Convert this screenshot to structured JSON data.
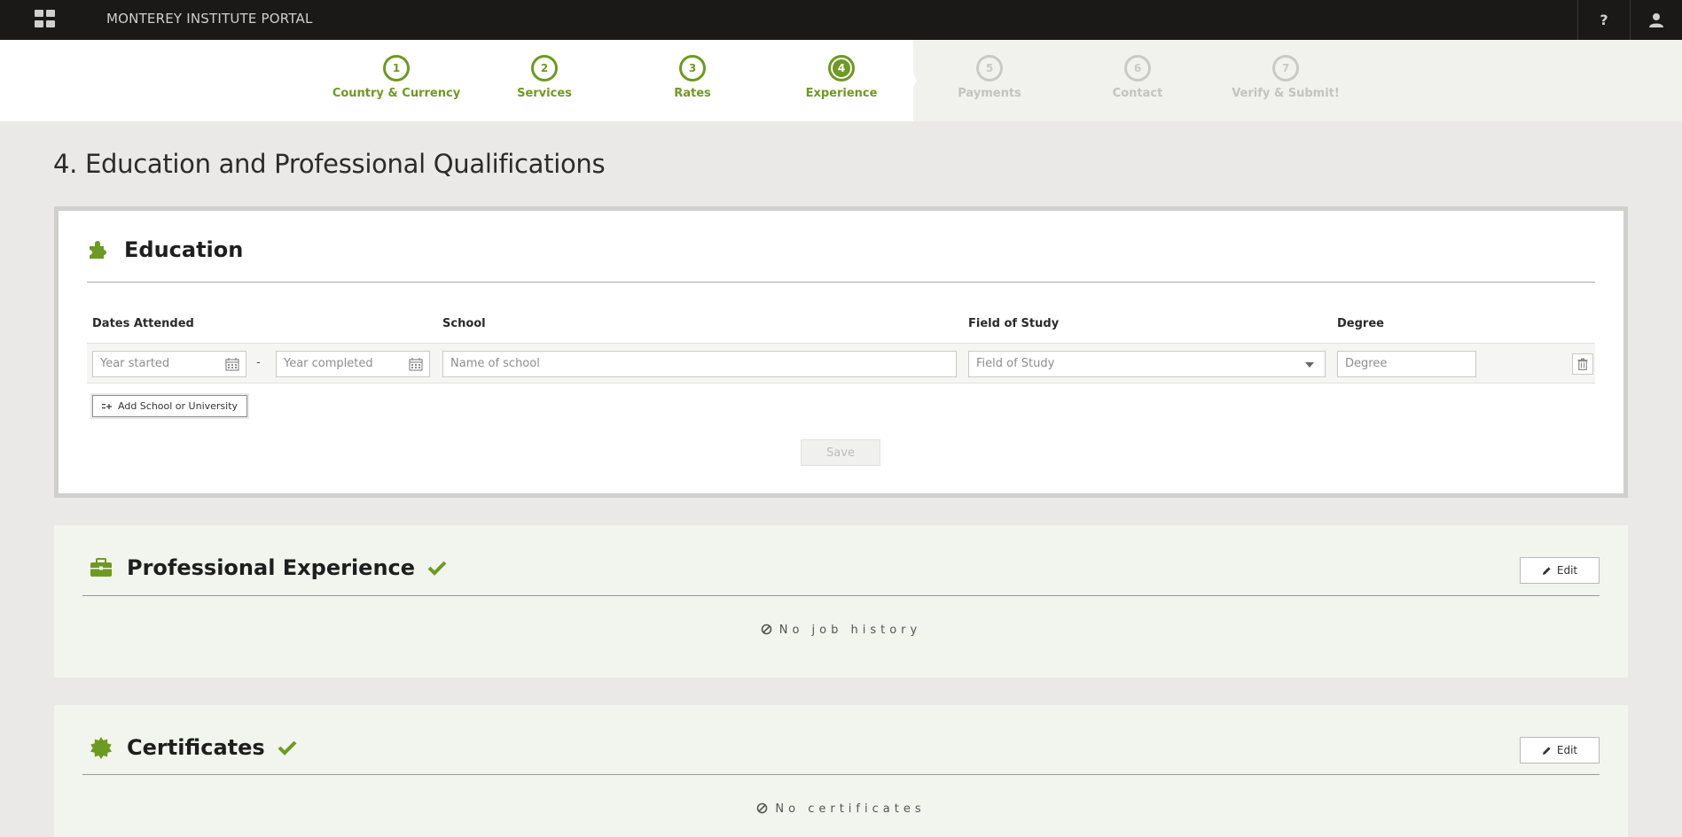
{
  "app": {
    "title": "MONTEREY INSTITUTE PORTAL",
    "help_label": "?"
  },
  "steps": [
    {
      "number": "1",
      "label": "Country & Currency",
      "state": "done"
    },
    {
      "number": "2",
      "label": "Services",
      "state": "done"
    },
    {
      "number": "3",
      "label": "Rates",
      "state": "done"
    },
    {
      "number": "4",
      "label": "Experience",
      "state": "current"
    },
    {
      "number": "5",
      "label": "Payments",
      "state": "future"
    },
    {
      "number": "6",
      "label": "Contact",
      "state": "future"
    },
    {
      "number": "7",
      "label": "Verify & Submit!",
      "state": "future"
    }
  ],
  "page": {
    "title": "4. Education and Professional Qualifications"
  },
  "education": {
    "title": "Education",
    "columns": {
      "dates": "Dates Attended",
      "school": "School",
      "field": "Field of Study",
      "degree": "Degree"
    },
    "row": {
      "year_started_placeholder": "Year started",
      "separator": "-",
      "year_completed_placeholder": "Year completed",
      "school_placeholder": "Name of school",
      "field_selected": "Field of Study",
      "degree_placeholder": "Degree"
    },
    "add_label": "Add School or University",
    "save_label": "Save"
  },
  "experience": {
    "title": "Professional Experience",
    "edit_label": "Edit",
    "empty_text": "No job history"
  },
  "certificates": {
    "title": "Certificates",
    "edit_label": "Edit",
    "empty_text": "No certificates"
  },
  "colors": {
    "accent": "#6d9a21",
    "topbar": "#1b1918",
    "page_bg": "#ebe9e7"
  }
}
